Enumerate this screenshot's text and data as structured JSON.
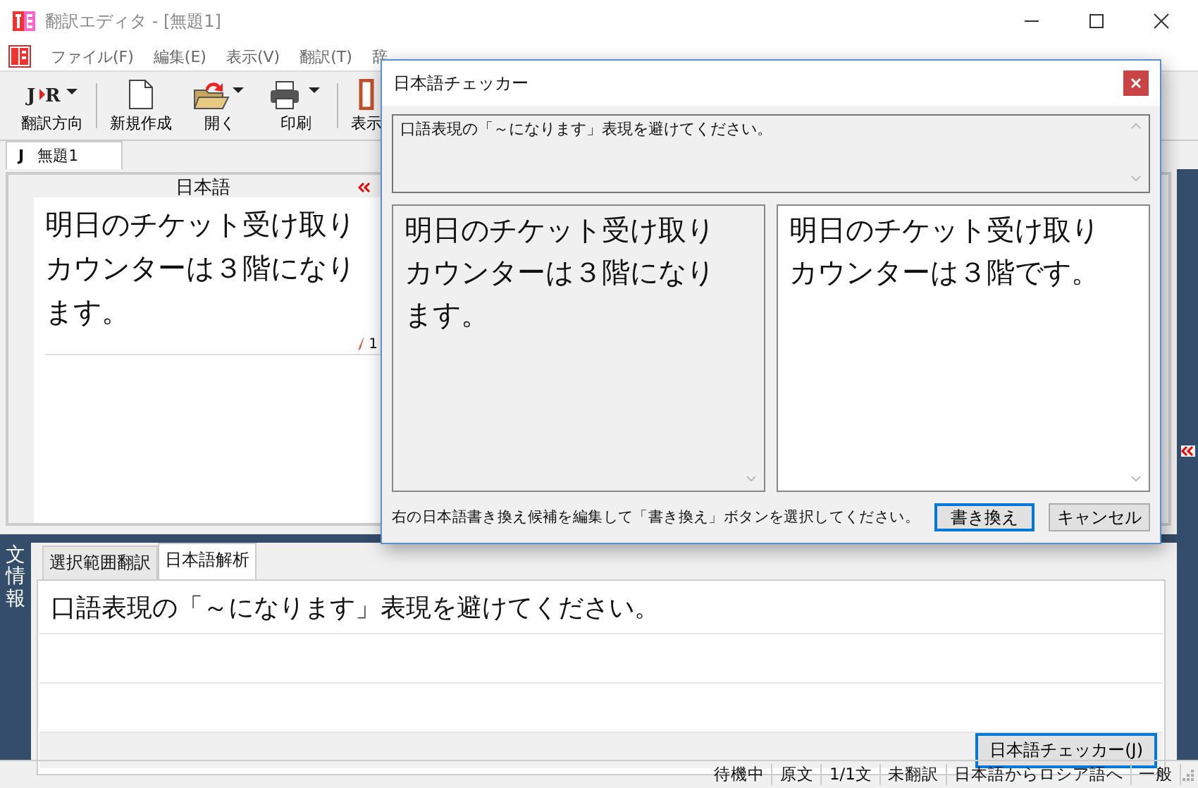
{
  "window": {
    "title": "翻訳エディタ - [無題1]"
  },
  "menu": [
    "ファイル(F)",
    "編集(E)",
    "表示(V)",
    "翻訳(T)",
    "辞"
  ],
  "toolbar": [
    {
      "label": "翻訳方向",
      "kind": "direction",
      "from": "J",
      "to": "R"
    },
    {
      "label": "新規作成",
      "kind": "new"
    },
    {
      "label": "開く",
      "kind": "open"
    },
    {
      "label": "印刷",
      "kind": "print"
    },
    {
      "label": "表示",
      "kind": "view"
    }
  ],
  "document_tabs": [
    {
      "prefix": "J",
      "label": "無題1",
      "selected": true
    }
  ],
  "editor": {
    "header": "日本語",
    "source_text": "明日のチケット受け取りカウンターは３階になります。",
    "line_number": "1"
  },
  "info_panel": {
    "side_label": "文情報",
    "tabs": [
      {
        "label": "選択範囲翻訳",
        "selected": false
      },
      {
        "label": "日本語解析",
        "selected": true
      }
    ],
    "message": "口語表現の「～になります」表現を避けてください。",
    "button": "日本語チェッカー(J)"
  },
  "status_bar": [
    "待機中",
    "原文",
    "1/1文",
    "未翻訳",
    "日本語からロシア語へ",
    "一般"
  ],
  "dialog": {
    "title": "日本語チェッカー",
    "message": "口語表現の「～になります」表現を避けてください。",
    "original": "明日のチケット受け取りカウンターは３階になります。",
    "suggestion": "明日のチケット受け取りカウンターは３階です。",
    "instruction": "右の日本語書き換え候補を編集して「書き換え」ボタンを選択してください。",
    "buttons": [
      {
        "label": "書き換え",
        "default": true
      },
      {
        "label": "キャンセル",
        "default": false
      }
    ]
  }
}
